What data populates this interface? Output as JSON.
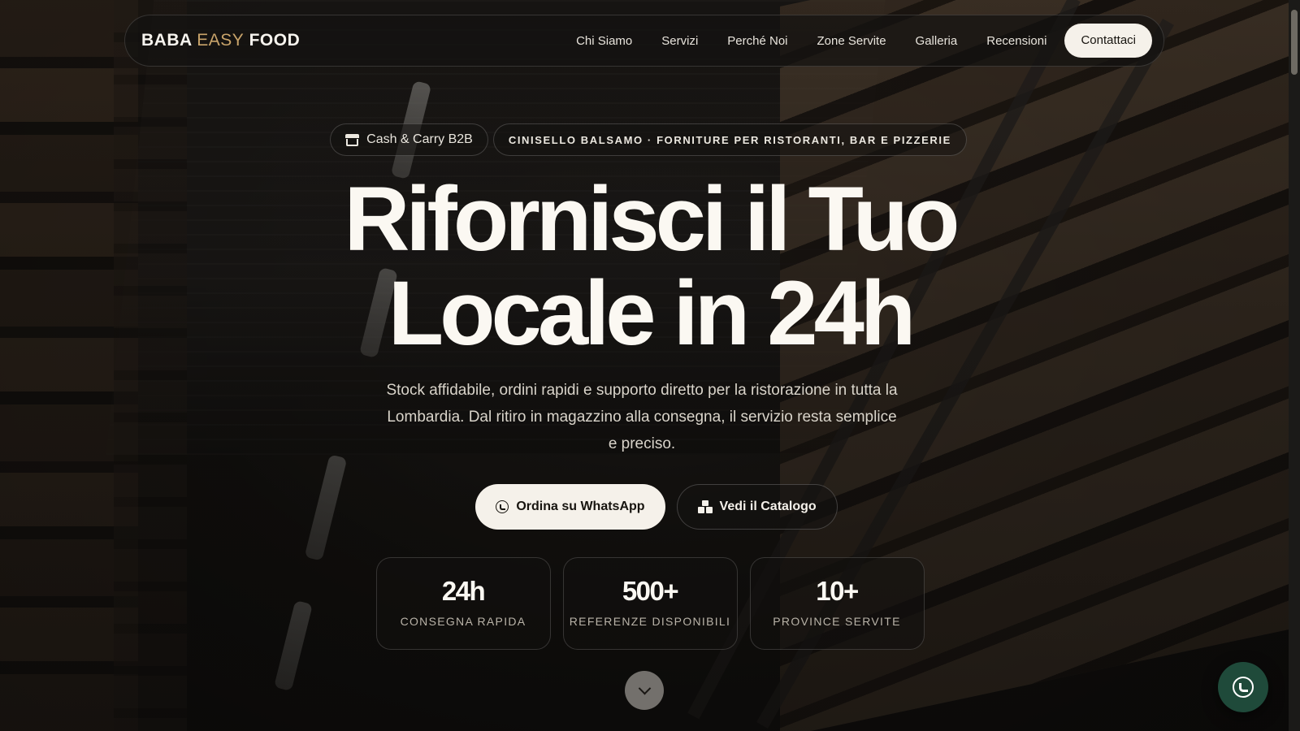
{
  "nav": {
    "logo": {
      "part1": "BABA",
      "part2": "EASY",
      "part3": "FOOD"
    },
    "links": [
      "Chi Siamo",
      "Servizi",
      "Perché Noi",
      "Zone Servite",
      "Galleria",
      "Recensioni"
    ],
    "cta": "Contattaci"
  },
  "hero": {
    "badge_primary": "Cash & Carry B2B",
    "badge_primary_icon": "store-icon",
    "badge_secondary": "CINISELLO BALSAMO · FORNITURE PER RISTORANTI, BAR E PIZZERIE",
    "headline_line1": "Rifornisci il Tuo",
    "headline_line2": "Locale in 24h",
    "lead": "Stock affidabile, ordini rapidi e supporto diretto per la ristorazione in tutta la Lombardia. Dal ritiro in magazzino alla consegna, il servizio resta semplice e preciso.",
    "cta_primary": "Ordina su WhatsApp",
    "cta_primary_icon": "whatsapp-icon",
    "cta_secondary": "Vedi il Catalogo",
    "cta_secondary_icon": "boxes-icon"
  },
  "stats": [
    {
      "value": "24h",
      "label": "CONSEGNA RAPIDA"
    },
    {
      "value": "500+",
      "label": "REFERENZE DISPONIBILI"
    },
    {
      "value": "10+",
      "label": "PROVINCE SERVITE"
    }
  ],
  "floating": {
    "icon": "whatsapp-icon",
    "color": "#1f4a3a"
  },
  "colors": {
    "accent_gold": "#c9a46a",
    "light": "#f5f1ea",
    "dark_bg": "#0d0c0b"
  }
}
